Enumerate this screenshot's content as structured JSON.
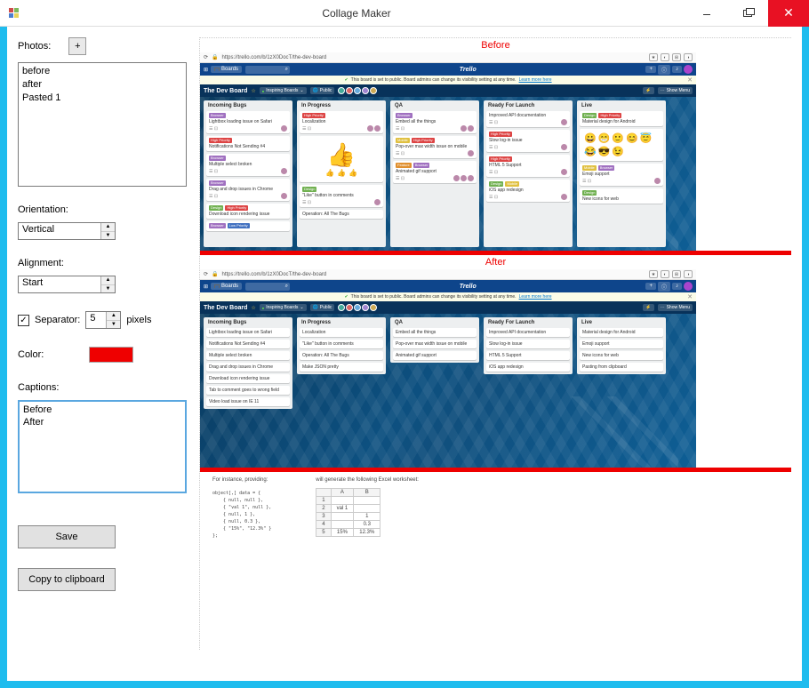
{
  "window": {
    "title": "Collage Maker"
  },
  "left": {
    "photos_label": "Photos:",
    "add_label": "+",
    "photos": [
      "before",
      "after",
      "Pasted 1"
    ],
    "orientation_label": "Orientation:",
    "orientation_value": "Vertical",
    "alignment_label": "Alignment:",
    "alignment_value": "Start",
    "separator_label": "Separator:",
    "separator_checked": true,
    "separator_value": "5",
    "separator_units": "pixels",
    "color_label": "Color:",
    "color_value": "#ef0000",
    "captions_label": "Captions:",
    "captions": [
      "Before",
      "After"
    ],
    "save_label": "Save",
    "copy_label": "Copy to clipboard"
  },
  "collage": {
    "caption1": "Before",
    "caption2": "After"
  },
  "trello": {
    "url": "https://trello.com/b/1zX0DocT/the-dev-board",
    "boards_btn": "Boards",
    "logo": "Trello",
    "notice_text": "This board is set to public. Board admins can change its visibility setting at any time.",
    "notice_link": "Learn more here",
    "board_name": "The Dev Board",
    "chip_team": "Inspiring Boards",
    "chip_public": "Public",
    "show_menu": "Show Menu",
    "before_lists": [
      {
        "name": "Incoming Bugs",
        "cards": [
          {
            "labels": [
              [
                "b-purple",
                "Browser"
              ]
            ],
            "title": "Lightbox loading issue on Safari",
            "foot": true,
            "avs": 1
          },
          {
            "labels": [
              [
                "b-red",
                "High Priority"
              ]
            ],
            "title": "Notifications Not Sending #4"
          },
          {
            "labels": [
              [
                "b-purple",
                "Browser"
              ]
            ],
            "title": "Multiple select broken",
            "foot": true
          },
          {
            "labels": [
              [
                "b-purple",
                "Browser"
              ]
            ],
            "title": "Drag and drop issues in Chrome",
            "foot": true
          },
          {
            "labels": [
              [
                "b-green",
                "Design"
              ],
              [
                "b-red",
                "High Priority"
              ]
            ],
            "title": "Download icon rendering issue"
          },
          {
            "labels": [
              [
                "b-purple",
                "Browser"
              ],
              [
                "b-blue",
                "Low Priority"
              ]
            ],
            "title": ""
          }
        ]
      },
      {
        "name": "In Progress",
        "cards": [
          {
            "labels": [
              [
                "b-red",
                "High Priority"
              ]
            ],
            "title": "Localization",
            "foot": true,
            "avs": 2
          },
          {
            "thumbs": true
          },
          {
            "labels": [
              [
                "b-green",
                "Design"
              ]
            ],
            "title": "\"Like\" button in comments",
            "foot": true
          },
          {
            "title": "Operation: All The Bugs"
          }
        ]
      },
      {
        "name": "QA",
        "cards": [
          {
            "labels": [
              [
                "b-purple",
                "Browser"
              ]
            ],
            "title": "Embed all the things",
            "foot": true,
            "avs": 2
          },
          {
            "labels": [
              [
                "b-yellow",
                "Mobile"
              ],
              [
                "b-red",
                "High Priority"
              ]
            ],
            "title": "Pop-over max width issue on mobile",
            "foot": true
          },
          {
            "labels": [
              [
                "b-orange",
                "Feature"
              ],
              [
                "b-purple",
                "Browser"
              ]
            ],
            "title": "Animated gif support",
            "foot": true,
            "avs": 3
          }
        ]
      },
      {
        "name": "Ready For Launch",
        "cards": [
          {
            "title": "Improved API documentation",
            "foot": true
          },
          {
            "labels": [
              [
                "b-red",
                "High Priority"
              ]
            ],
            "title": "Slow log-in issue",
            "foot": true
          },
          {
            "labels": [
              [
                "b-red",
                "High Priority"
              ]
            ],
            "title": "HTML 5 Support",
            "foot": true
          },
          {
            "labels": [
              [
                "b-green",
                "Design"
              ],
              [
                "b-yellow",
                "Mobile"
              ]
            ],
            "title": "iOS app redesign",
            "foot": true
          }
        ]
      },
      {
        "name": "Live",
        "cards": [
          {
            "labels": [
              [
                "b-green",
                "Design"
              ],
              [
                "b-red",
                "High Priority"
              ]
            ],
            "title": "Material design for Android"
          },
          {
            "emoji": true
          },
          {
            "labels": [
              [
                "b-yellow",
                "Mobile"
              ],
              [
                "b-purple",
                "Browser"
              ]
            ],
            "title": "Emoji support",
            "foot": true
          },
          {
            "labels": [
              [
                "b-green",
                "Design"
              ]
            ],
            "title": "New icons for web"
          }
        ]
      }
    ],
    "after_lists": [
      {
        "name": "Incoming Bugs",
        "cards": [
          {
            "title": "Lightbox loading issue on Safari"
          },
          {
            "title": "Notifications Not Sending #4"
          },
          {
            "title": "Multiple select broken"
          },
          {
            "title": "Drag and drop issues in Chrome"
          },
          {
            "title": "Download icon rendering issue"
          },
          {
            "title": "Tab to comment goes to wrong field"
          },
          {
            "title": "Video load issue on IE 11"
          }
        ]
      },
      {
        "name": "In Progress",
        "cards": [
          {
            "title": "Localization"
          },
          {
            "title": "\"Like\" button in comments"
          },
          {
            "title": "Operation: All The Bugs"
          },
          {
            "title": "Make JSON pretty"
          }
        ]
      },
      {
        "name": "QA",
        "cards": [
          {
            "title": "Embed all the things"
          },
          {
            "title": "Pop-over max width issue on mobile"
          },
          {
            "title": "Animated gif support"
          }
        ]
      },
      {
        "name": "Ready For Launch",
        "cards": [
          {
            "title": "Improved API documentation"
          },
          {
            "title": "Slow log-in issue"
          },
          {
            "title": "HTML 5 Support"
          },
          {
            "title": "iOS app redesign"
          }
        ]
      },
      {
        "name": "Live",
        "cards": [
          {
            "title": "Material design for Android"
          },
          {
            "title": "Emoji support"
          },
          {
            "title": "New icons for web"
          },
          {
            "title": "Pasting from clipboard"
          }
        ]
      }
    ]
  },
  "thumb3": {
    "intro": "For instance, providing:",
    "code": "object[,] data = {\n    { null, null },\n    { \"val 1\", null },\n    { null, 1 },\n    { null, 0.3 },\n    { \"15%\", \"12.3%\" }\n};",
    "excel_intro": "will generate the following Excel worksheet:",
    "table": {
      "cols": [
        "",
        "A",
        "B"
      ],
      "rows": [
        [
          "1",
          "",
          ""
        ],
        [
          "2",
          "val 1",
          ""
        ],
        [
          "3",
          "",
          "1"
        ],
        [
          "4",
          "",
          "0.3"
        ],
        [
          "5",
          "15%",
          "12.3%"
        ]
      ]
    }
  }
}
